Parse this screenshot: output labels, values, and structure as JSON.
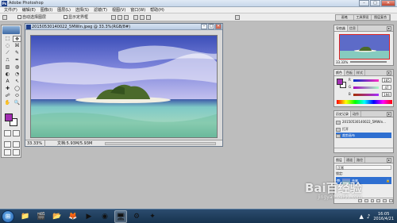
{
  "window": {
    "title": "Adobe Photoshop",
    "app_icon": "Ps"
  },
  "window_buttons": {
    "minimize": "–",
    "maximize": "□",
    "close": "✕"
  },
  "menu": [
    "文件(F)",
    "编辑(E)",
    "图像(I)",
    "图层(L)",
    "选择(S)",
    "滤镜(T)",
    "视图(V)",
    "窗口(W)",
    "帮助(H)"
  ],
  "options": {
    "auto_select": "自动选择图层",
    "show_bounds": "显示定界框",
    "brush_tabs": [
      "画笔",
      "工具预设",
      "图层复合"
    ]
  },
  "document": {
    "title": "20150530140022_5MWin.jpeg @ 33.3%(RGB/8#)",
    "zoom": "33.33%",
    "info": "文档:5.93M/5.93M"
  },
  "toolbox": {
    "tools": [
      "⬚",
      "✥",
      "◌",
      "⌘",
      "⟋",
      "✎",
      "⎍",
      "✒",
      "▧",
      "◍",
      "◐",
      "◔",
      "A",
      "↖",
      "✚",
      "◯",
      "☍",
      "⬭",
      "✋",
      "🔍"
    ],
    "fg_color": "#a22fb2",
    "bg_color": "#ffffff"
  },
  "navigator": {
    "tabs": [
      "导航器",
      "信息"
    ],
    "zoom": "33.33%"
  },
  "color_panel": {
    "tabs": [
      "颜色",
      "色板",
      "样式"
    ],
    "channels": [
      {
        "label": "R",
        "value": "165"
      },
      {
        "label": "G",
        "value": "47"
      },
      {
        "label": "B",
        "value": "194"
      }
    ]
  },
  "history": {
    "tabs": [
      "历史记录",
      "动作"
    ],
    "items": [
      "20150530140022_5MWin...",
      "打开",
      "裁剪画布"
    ]
  },
  "layers": {
    "tabs": [
      "图层",
      "通道",
      "路径"
    ],
    "blend": "正常",
    "lock": "锁定:",
    "layer_name": "背景",
    "lock_icon": "🔒"
  },
  "watermark": {
    "main": "Bai百经验",
    "sub": "jingyan.baidu.com"
  },
  "taskbar": {
    "start": "⊞",
    "apps": [
      "📁",
      "🎬",
      "📂",
      "🦊",
      "▶",
      "◉",
      "🖥",
      "⚙",
      "✦"
    ],
    "time": "16:05",
    "date": "2016/4/21"
  }
}
